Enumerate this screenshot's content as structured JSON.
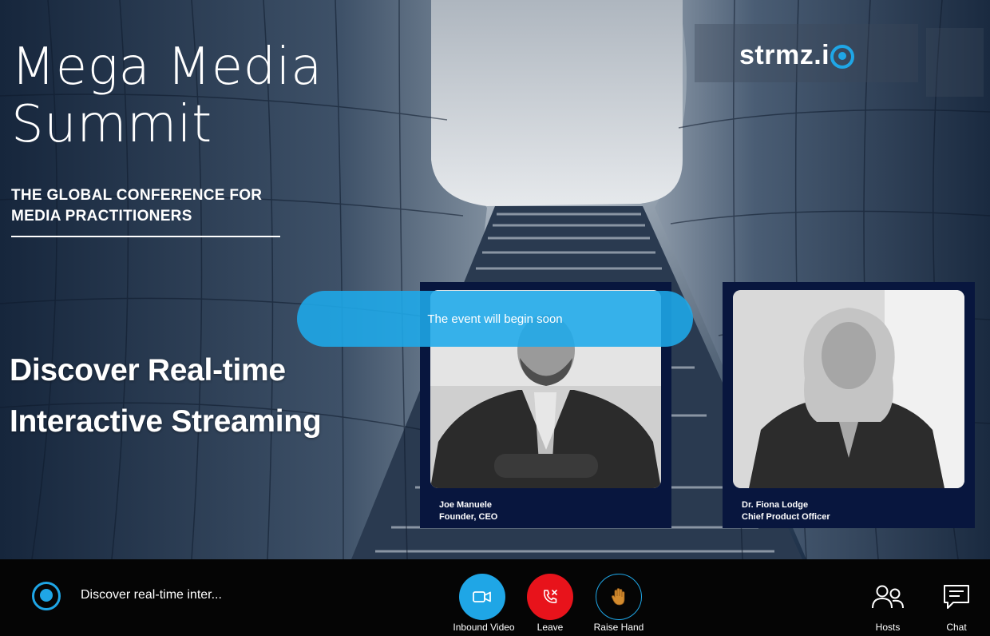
{
  "event": {
    "title_line1": "Mega Media",
    "title_line2": "Summit",
    "subtitle_line1": "THE GLOBAL CONFERENCE FOR",
    "subtitle_line2": "MEDIA PRACTITIONERS",
    "tagline_line1": "Discover Real-time",
    "tagline_line2": "Interactive Streaming"
  },
  "brand": {
    "logo_text": "strmz.i",
    "accent": "#1fa6e6"
  },
  "status_banner": "The event will begin soon",
  "speakers": [
    {
      "name": "Joe Manuele",
      "role": "Founder, CEO"
    },
    {
      "name": "Dr. Fiona Lodge",
      "role": "Chief Product Officer"
    }
  ],
  "control_bar": {
    "event_title": "Discover real-time inter...",
    "inbound_video_label": "Inbound Video",
    "leave_label": "Leave",
    "raise_hand_label": "Raise Hand",
    "hosts_label": "Hosts",
    "chat_label": "Chat",
    "colors": {
      "video": "#1fa6e6",
      "leave": "#e8131b",
      "raise_hand_ring": "#1fa6e6"
    }
  }
}
